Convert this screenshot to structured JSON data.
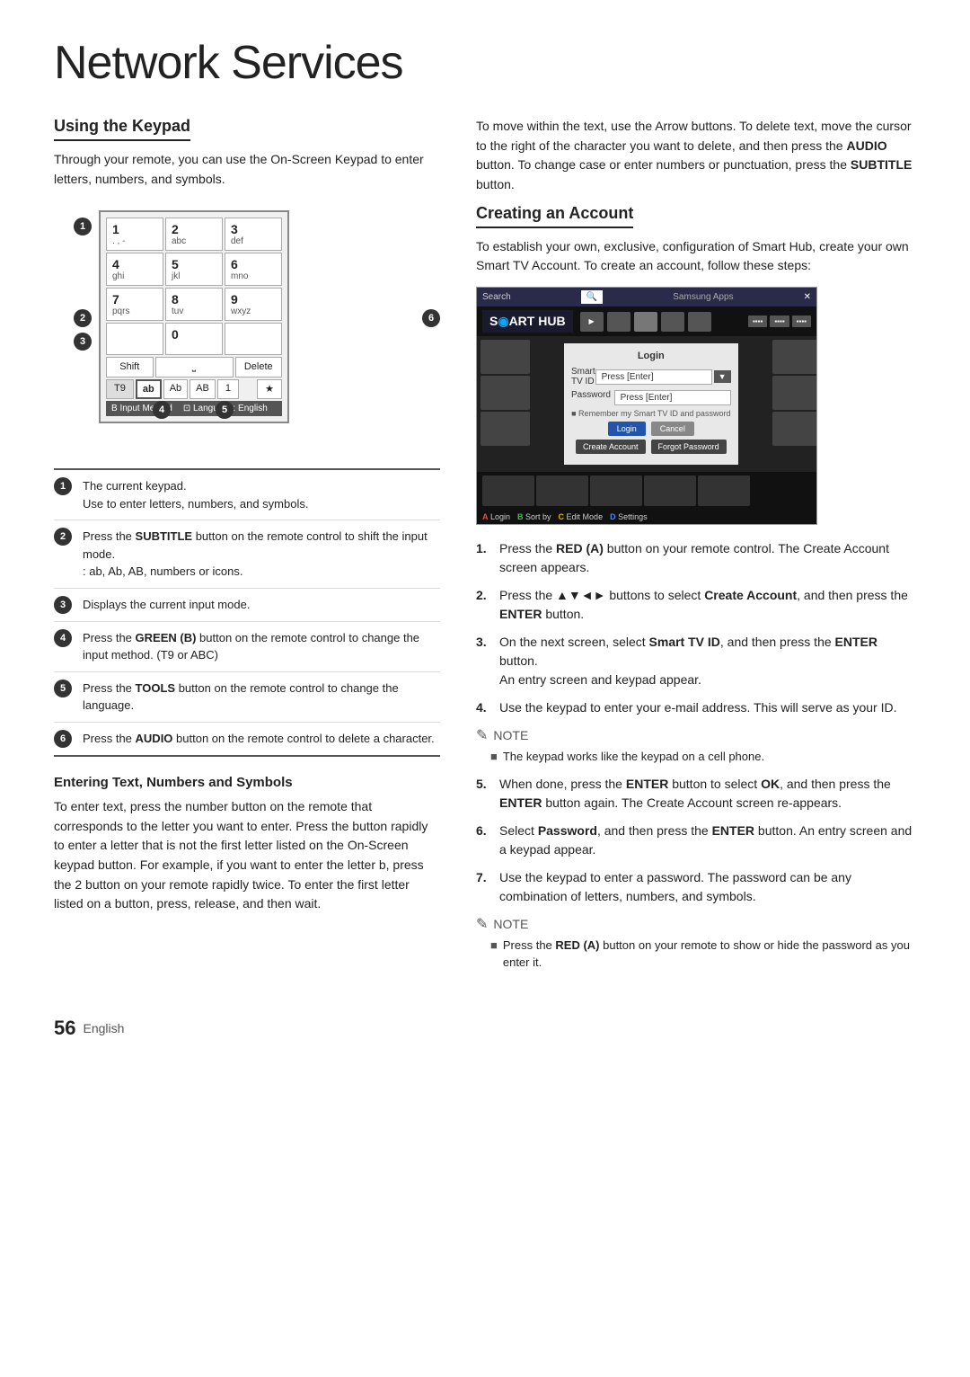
{
  "page": {
    "title": "Network Services",
    "footer_num": "56",
    "footer_lang": "English"
  },
  "left": {
    "section1_title": "Using the Keypad",
    "section1_intro": "Through your remote, you can use the On-Screen Keypad to enter letters, numbers, and symbols.",
    "keypad": {
      "keys": [
        {
          "num": "1",
          "letters": ". , -"
        },
        {
          "num": "2",
          "letters": "abc"
        },
        {
          "num": "3",
          "letters": "def"
        },
        {
          "num": "4",
          "letters": "ghi"
        },
        {
          "num": "5",
          "letters": "jkl"
        },
        {
          "num": "6",
          "letters": "mno"
        },
        {
          "num": "7",
          "letters": "pqrs"
        },
        {
          "num": "8",
          "letters": "tuv"
        },
        {
          "num": "9",
          "letters": "wxyz"
        },
        {
          "num": "",
          "letters": ""
        },
        {
          "num": "0",
          "letters": ""
        },
        {
          "num": "",
          "letters": ""
        }
      ],
      "shift": "Shift",
      "space": "⎵",
      "delete": "Delete",
      "mode_t9": "T9",
      "mode_ab": "ab",
      "mode_Ab": "Ab",
      "mode_AB": "AB",
      "mode_1": "1",
      "mode_star": "★",
      "footer_input": "B Input Method",
      "footer_lang": "⊡ Language: English"
    },
    "annotations": [
      {
        "num": "1",
        "text": "The current keypad.\nUse to enter letters, numbers, and symbols."
      },
      {
        "num": "2",
        "text": "Press the SUBTITLE button on the remote control to shift the input mode.\n: ab, Ab, AB, numbers or icons.",
        "bold_word": "SUBTITLE"
      },
      {
        "num": "3",
        "text": "Displays the current input mode."
      },
      {
        "num": "4",
        "text": "Press the GREEN (B) button on the remote control to change the input method. (T9 or ABC)",
        "bold_word": "GREEN (B)"
      },
      {
        "num": "5",
        "text": "Press the TOOLS button on the remote control to change the language.",
        "bold_word": "TOOLS"
      },
      {
        "num": "6",
        "text": "Press the AUDIO button on the remote control to delete a character.",
        "bold_word": "AUDIO"
      }
    ],
    "section2_title": "Entering Text, Numbers and Symbols",
    "section2_body": "To enter text, press the number button on the remote that corresponds to the letter you want to enter. Press the button rapidly to enter a letter that is not the first letter listed on the On-Screen keypad button. For example, if you want to enter the letter b, press the 2 button on your remote rapidly twice. To enter the first letter listed on a button, press, release, and then wait."
  },
  "right": {
    "para1": "To move within the text, use the Arrow buttons. To delete text, move the cursor to the right of the character you want to delete, and then press the AUDIO button. To change case or enter numbers or punctuation, press the SUBTITLE button.",
    "bold1": "AUDIO",
    "bold2": "SUBTITLE",
    "section_creating_title": "Creating an Account",
    "creating_intro": "To establish your own, exclusive, configuration of Smart Hub, create your own Smart TV Account. To create an account, follow these steps:",
    "steps": [
      {
        "num": "1.",
        "text": "Press the RED (A) button on your remote control. The Create Account screen appears.",
        "bold": "RED (A)"
      },
      {
        "num": "2.",
        "text": "Press the ▲▼◄► buttons to select Create Account, and then press the ENTER button.",
        "bold": "Create Account"
      },
      {
        "num": "3.",
        "text": "On the next screen, select Smart TV ID, and then press the ENTER button.\nAn entry screen and keypad appear.",
        "bold": "Smart TV ID"
      },
      {
        "num": "4.",
        "text": "Use the keypad to enter your e-mail address. This will serve as your ID."
      },
      {
        "num": "5.",
        "text": "When done, press the ENTER button to select OK, and then press the ENTER button again. The Create Account screen re-appears.",
        "bold": "ENTER"
      },
      {
        "num": "6.",
        "text": "Select Password, and then press the ENTER button. An entry screen and a keypad appear.",
        "bold": "Password"
      },
      {
        "num": "7.",
        "text": "Use the keypad to enter a password. The password can be any combination of letters, numbers, and symbols."
      }
    ],
    "note1_title": "NOTE",
    "note1_items": [
      "The keypad works like the keypad on a cell phone."
    ],
    "note2_title": "NOTE",
    "note2_items": [
      "Press the RED (A) button on your remote to show or hide the password as you enter it."
    ],
    "note2_bold": "RED (A)"
  }
}
